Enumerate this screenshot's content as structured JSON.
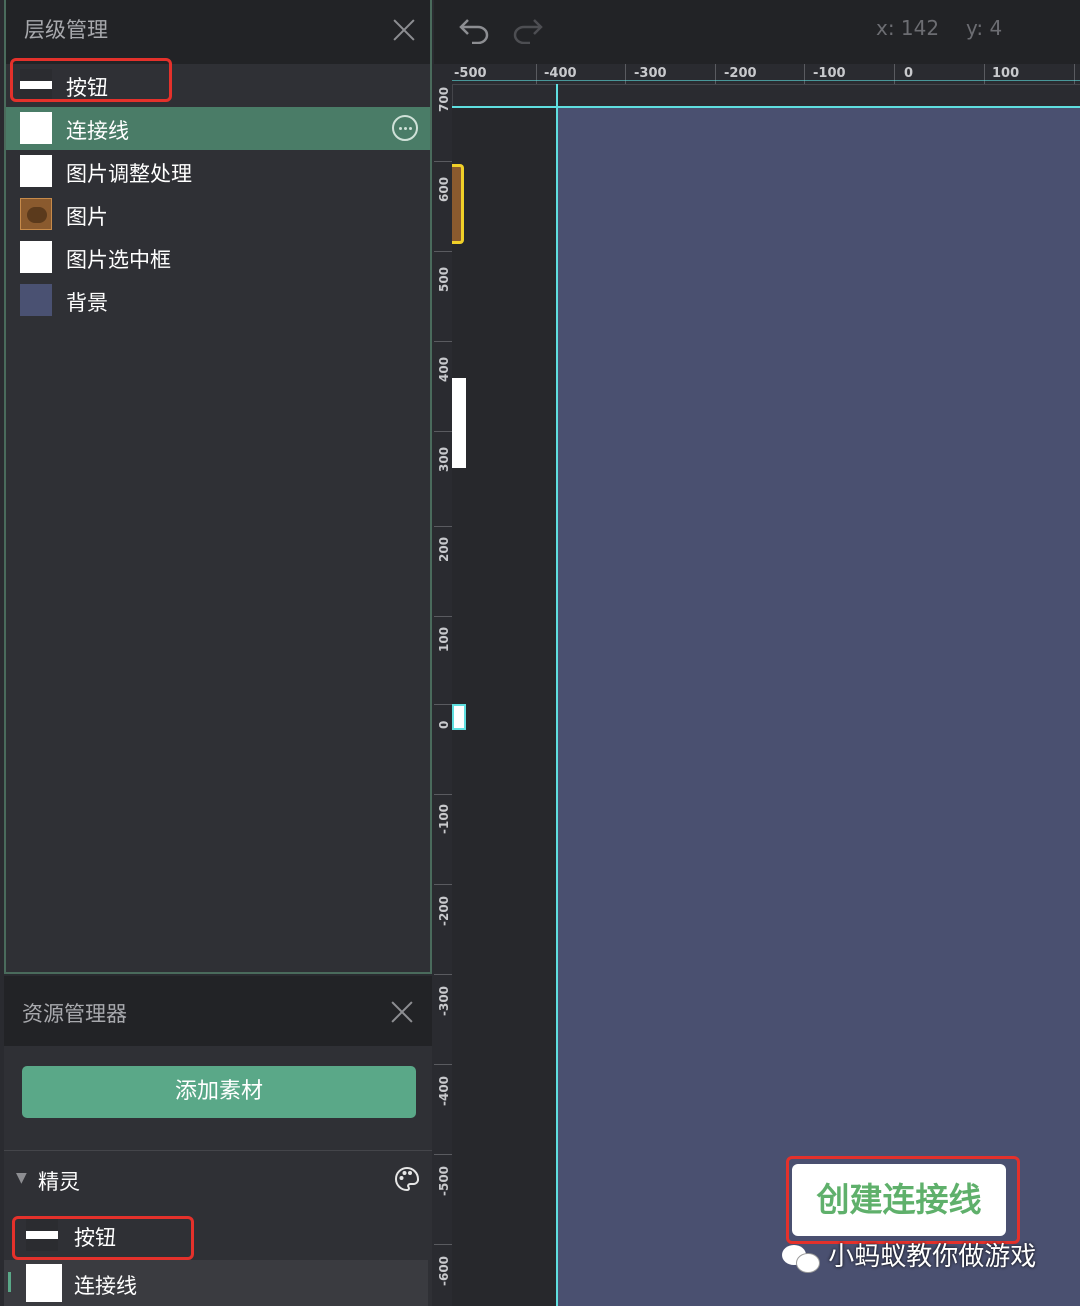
{
  "layers_panel": {
    "title": "层级管理",
    "items": [
      {
        "label": "按钮",
        "thumb": "button-thumb"
      },
      {
        "label": "连接线",
        "thumb": "white-thumb",
        "selected": true
      },
      {
        "label": "图片调整处理",
        "thumb": "white-thumb"
      },
      {
        "label": "图片",
        "thumb": "bear-thumb"
      },
      {
        "label": "图片选中框",
        "thumb": "white-thumb"
      },
      {
        "label": "背景",
        "thumb": "background-thumb"
      }
    ]
  },
  "assets_panel": {
    "title": "资源管理器",
    "add_button": "添加素材",
    "group_label": "精灵",
    "items": [
      {
        "label": "按钮",
        "thumb": "button-thumb"
      },
      {
        "label": "连接线",
        "thumb": "white-thumb"
      }
    ]
  },
  "toolbar": {
    "coord_x": "x: 142",
    "coord_y": "y: 4"
  },
  "ruler_top": [
    "-500",
    "-400",
    "-300",
    "-200",
    "-100",
    "0",
    "100"
  ],
  "ruler_left": [
    "700",
    "600",
    "500",
    "400",
    "300",
    "200",
    "100",
    "0",
    "-100",
    "-200",
    "-300",
    "-400",
    "-500",
    "-600"
  ],
  "canvas": {
    "create_line_button": "创建连接线"
  },
  "watermark": "小蚂蚁教你做游戏",
  "colors": {
    "accent_green": "#5aa888",
    "selected_row": "#4a7c67",
    "stage": "#4a5070",
    "highlight_red": "#e4312b",
    "guide_cyan": "#5fdfe0"
  }
}
